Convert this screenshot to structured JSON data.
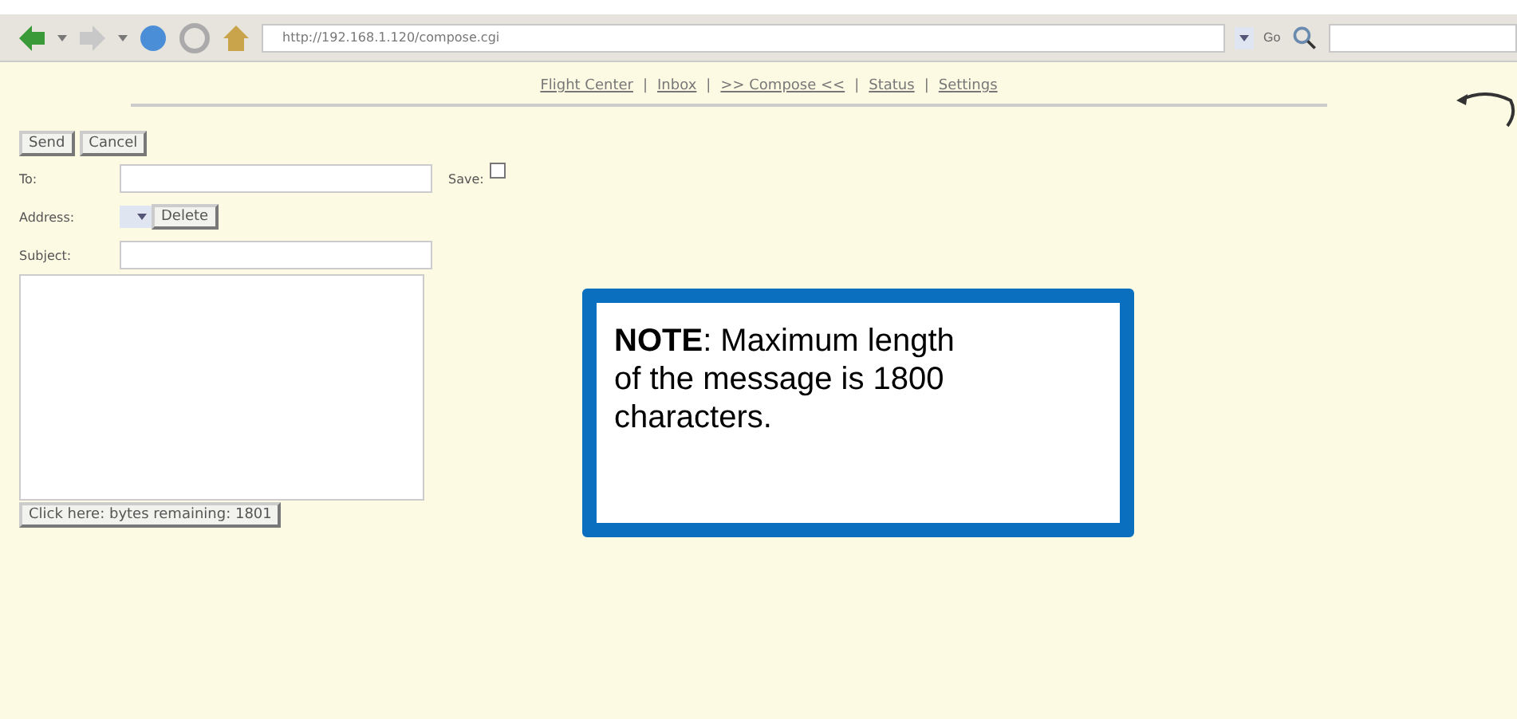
{
  "browser": {
    "url": "http://192.168.1.120/compose.cgi",
    "go": "Go"
  },
  "nav": [
    "Flight Center",
    "Inbox",
    ">> Compose <<",
    "Status",
    "Settings"
  ],
  "nav_separator": "|",
  "buttons": [
    "Send",
    "Cancel"
  ],
  "form": {
    "to_label": "To:",
    "save_label": "Save:",
    "save_checked": false,
    "address_label": "Address:",
    "delete": "Delete",
    "subject_label": "Subject:",
    "counter_button": "Click here: bytes remaining: 1801"
  },
  "note": {
    "text": "**NOTE**: Maximum length of the message is 1800 characters."
  }
}
